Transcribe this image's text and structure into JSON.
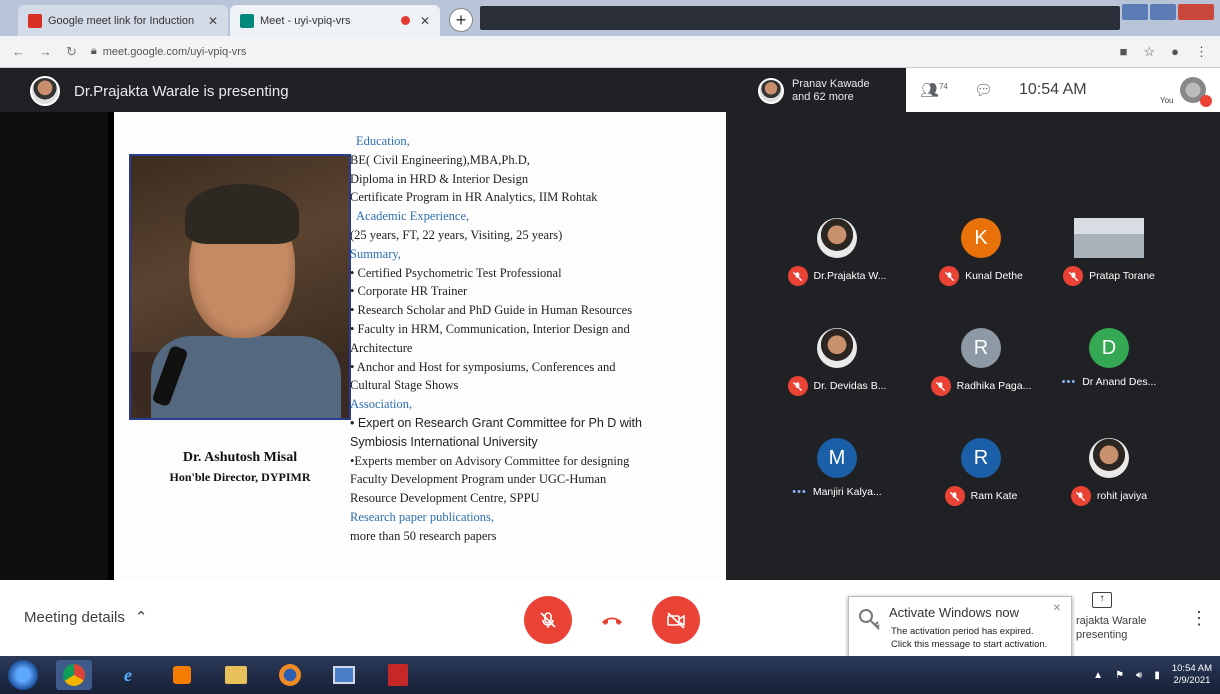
{
  "browser": {
    "tabs": [
      {
        "label": "Google meet link for Induction",
        "favicon_color": "#d93025",
        "active": false
      },
      {
        "label": "Meet - uyi-vpiq-vrs",
        "favicon_color": "#00897b",
        "active": true
      }
    ],
    "new_tab_label": "+",
    "url": "meet.google.com/uyi-vpiq-vrs"
  },
  "meet_header": {
    "presenting_text": "Dr.Prajakta Warale is presenting",
    "participants_pill_line1": "Pranav Kawade",
    "participants_pill_line2": "and 62 more",
    "people_count": "74",
    "clock": "10:54 AM",
    "you_label": "You"
  },
  "slide": {
    "name": "Dr. Ashutosh Misal",
    "title": "Hon'ble Director, DYPIMR",
    "lines": [
      {
        "text": "Education,",
        "style": "hd indent"
      },
      {
        "text": "BE( Civil Engineering),MBA,Ph.D,",
        "style": ""
      },
      {
        "text": "Diploma in HRD & Interior Design",
        "style": ""
      },
      {
        "text": "Certificate Program in HR Analytics, IIM Rohtak",
        "style": ""
      },
      {
        "text": "Academic Experience,",
        "style": "hd indent"
      },
      {
        "text": "(25 years, FT, 22 years, Visiting, 25 years)",
        "style": ""
      },
      {
        "text": "Summary,",
        "style": "hd"
      },
      {
        "text": "• Certified Psychometric Test Professional",
        "style": ""
      },
      {
        "text": "• Corporate HR Trainer",
        "style": ""
      },
      {
        "text": "• Research Scholar and PhD Guide in Human Resources",
        "style": ""
      },
      {
        "text": "• Faculty in HRM, Communication, Interior Design and",
        "style": ""
      },
      {
        "text": "Architecture",
        "style": ""
      },
      {
        "text": "• Anchor and Host for symposiums, Conferences and",
        "style": ""
      },
      {
        "text": "Cultural Stage Shows",
        "style": ""
      },
      {
        "text": "Association,",
        "style": "hd"
      },
      {
        "text": "• Expert on Research Grant Committee for Ph D with",
        "style": "sans"
      },
      {
        "text": "Symbiosis International University",
        "style": "sans"
      },
      {
        "text": "•Experts member on Advisory Committee for designing",
        "style": ""
      },
      {
        "text": "Faculty Development Program under UGC-Human",
        "style": ""
      },
      {
        "text": "Resource Development Centre, SPPU",
        "style": ""
      },
      {
        "text": "Research paper publications,",
        "style": "hd"
      },
      {
        "text": "more than 50 research papers",
        "style": ""
      }
    ]
  },
  "participants": [
    {
      "name": "Dr.Prajakta W...",
      "initial": "",
      "color": "photo",
      "status": "muted"
    },
    {
      "name": "Kunal Dethe",
      "initial": "K",
      "color": "#e8710a",
      "status": "muted"
    },
    {
      "name": "Pratap Torane",
      "initial": "",
      "color": "photo-building",
      "status": "muted"
    },
    {
      "name": "Dr. Devidas B...",
      "initial": "",
      "color": "photo",
      "status": "muted"
    },
    {
      "name": "Radhika Paga...",
      "initial": "R",
      "color": "#8d9aa6",
      "status": "muted"
    },
    {
      "name": "Dr Anand Des...",
      "initial": "D",
      "color": "#34a853",
      "status": "speaking"
    },
    {
      "name": "Manjiri Kalya...",
      "initial": "M",
      "color": "#1a5fa8",
      "status": "speaking"
    },
    {
      "name": "Ram Kate",
      "initial": "R",
      "color": "#1a5fa8",
      "status": "muted"
    },
    {
      "name": "rohit javiya",
      "initial": "",
      "color": "photo",
      "status": "muted"
    }
  ],
  "controls": {
    "meeting_details": "Meeting details",
    "present_line1": "rajakta Warale",
    "present_line2": "presenting"
  },
  "activation": {
    "title": "Activate Windows now",
    "message1": "The activation period has expired.",
    "message2": "Click this message to start activation."
  },
  "taskbar": {
    "time": "10:54 AM",
    "date": "2/9/2021"
  }
}
